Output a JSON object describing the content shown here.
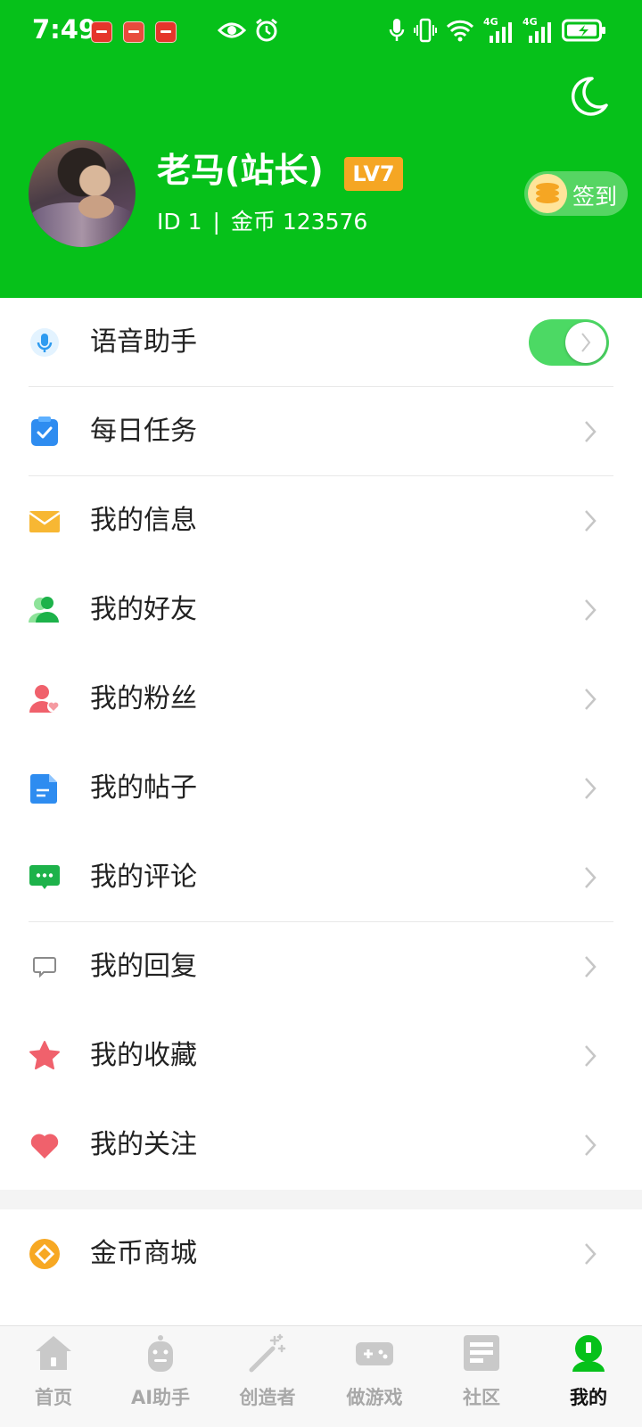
{
  "status_bar": {
    "time": "7:49",
    "network_1": "4G",
    "network_2": "4G"
  },
  "header": {
    "username": "老马(站长)",
    "level": "LV7",
    "id_text": "ID 1",
    "separator": "|",
    "coins_text": "金币 123576",
    "signin_label": "签到",
    "bg_color": "#06C11A"
  },
  "menu": {
    "voice_assistant": {
      "label": "语音助手",
      "enabled": true
    },
    "items": [
      {
        "label": "每日任务",
        "icon": "task-icon"
      },
      {
        "label": "我的信息",
        "icon": "mail-icon"
      },
      {
        "label": "我的好友",
        "icon": "friends-icon"
      },
      {
        "label": "我的粉丝",
        "icon": "fans-icon"
      },
      {
        "label": "我的帖子",
        "icon": "post-icon"
      },
      {
        "label": "我的评论",
        "icon": "comment-icon"
      },
      {
        "label": "我的回复",
        "icon": "reply-icon"
      },
      {
        "label": "我的收藏",
        "icon": "star-icon"
      },
      {
        "label": "我的关注",
        "icon": "heart-icon"
      }
    ],
    "coin_mall": {
      "label": "金币商城",
      "icon": "coin-mall-icon"
    }
  },
  "tabbar": {
    "tabs": [
      {
        "label": "首页",
        "icon": "home-icon"
      },
      {
        "label": "AI助手",
        "icon": "robot-icon"
      },
      {
        "label": "创造者",
        "icon": "magic-wand-icon"
      },
      {
        "label": "做游戏",
        "icon": "gamepad-icon"
      },
      {
        "label": "社区",
        "icon": "community-icon"
      },
      {
        "label": "我的",
        "icon": "profile-icon"
      }
    ],
    "active": "我的"
  }
}
